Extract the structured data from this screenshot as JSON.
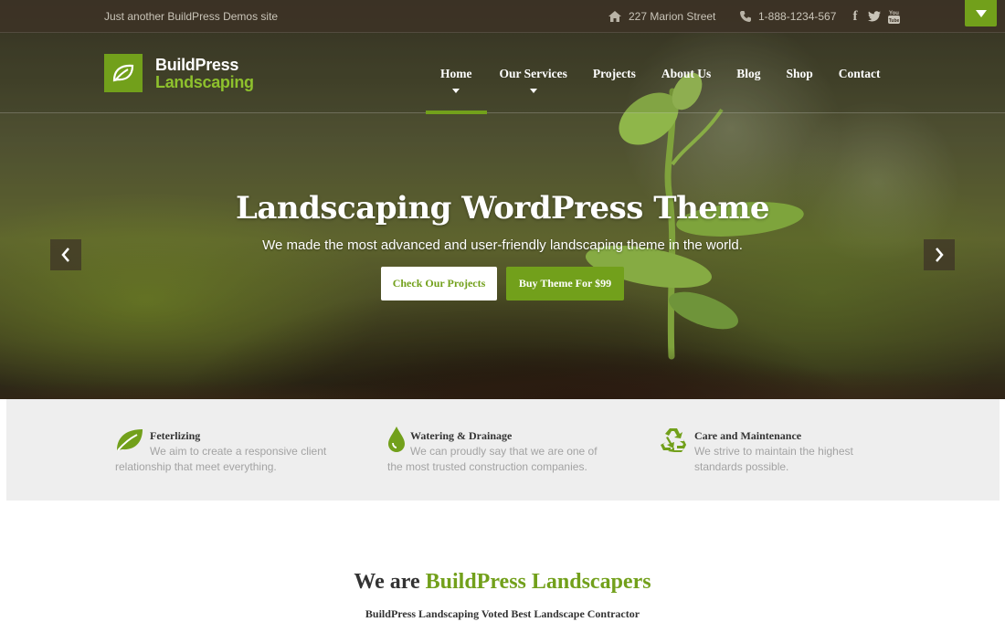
{
  "topbar": {
    "tagline": "Just another BuildPress Demos site",
    "address": "227 Marion Street",
    "phone": "1-888-1234-567",
    "social_icons": [
      "facebook-icon",
      "twitter-icon",
      "youtube-icon"
    ]
  },
  "logo": {
    "line1": "BuildPress",
    "line2": "Landscaping"
  },
  "nav": {
    "items": [
      {
        "label": "Home",
        "active": true,
        "has_dropdown": true
      },
      {
        "label": "Our Services",
        "active": false,
        "has_dropdown": true
      },
      {
        "label": "Projects",
        "active": false,
        "has_dropdown": false
      },
      {
        "label": "About Us",
        "active": false,
        "has_dropdown": false
      },
      {
        "label": "Blog",
        "active": false,
        "has_dropdown": false
      },
      {
        "label": "Shop",
        "active": false,
        "has_dropdown": false
      },
      {
        "label": "Contact",
        "active": false,
        "has_dropdown": false
      }
    ]
  },
  "slider": {
    "title": "Landscaping WordPress Theme",
    "subtitle": "We made the most advanced and user-friendly landscaping theme in the world.",
    "button_primary": "Check Our Projects",
    "button_secondary": "Buy Theme For $99"
  },
  "features": [
    {
      "icon": "leaf-icon",
      "title": "Feterlizing",
      "text_line1": "We aim to create a responsive client",
      "text_line2": "relationship that meet everything."
    },
    {
      "icon": "water-drop-icon",
      "title": "Watering & Drainage",
      "text_line1": "We can proudly say that we are one of",
      "text_line2": "the most trusted construction companies."
    },
    {
      "icon": "recycle-icon",
      "title": "Care and Maintenance",
      "text_line1": "We strive to maintain the highest",
      "text_line2": "standards possible."
    }
  ],
  "intro": {
    "title_part1": "We are",
    "title_part2": "BuildPress Landscapers",
    "subtitle": "BuildPress Landscaping Voted Best Landscape Contractor"
  },
  "colors": {
    "accent": "#72a01b",
    "logo_green": "#8ec12d",
    "feature_bg": "#eeeeee",
    "heading_text": "#333333",
    "muted_text": "#a3a3a3"
  }
}
